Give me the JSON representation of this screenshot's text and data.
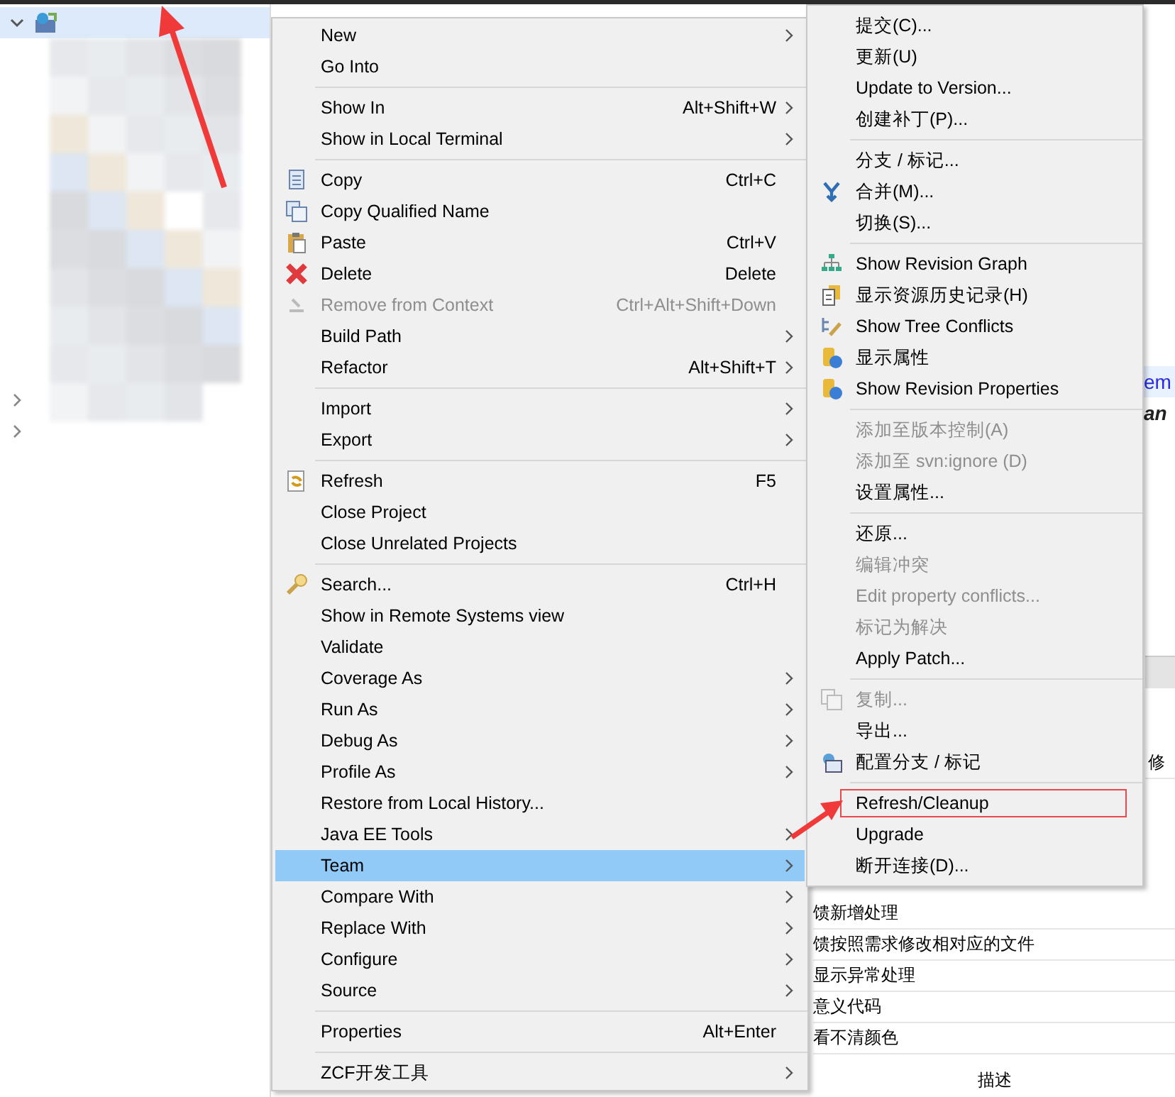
{
  "tree": {
    "items": [
      {
        "expanded": true
      },
      {
        "expanded": false
      },
      {
        "expanded": false
      }
    ]
  },
  "editor": {
    "lines": [
      {
        "text": "em",
        "current": true
      },
      {
        "text": "an",
        "current": false
      }
    ]
  },
  "table": {
    "rows": [
      "修",
      "馈新增处理",
      "馈按照需求修改相对应的文件",
      "显示异常处理",
      "意义代码",
      "看不清颜色"
    ],
    "header": "描述"
  },
  "menu": {
    "items": [
      {
        "kind": "item",
        "label": "New",
        "submenu": true,
        "disabled": false,
        "selected": false
      },
      {
        "kind": "item",
        "label": "Go Into",
        "submenu": false,
        "disabled": false,
        "selected": false
      },
      {
        "kind": "separator"
      },
      {
        "kind": "item",
        "label": "Show In",
        "shortcut": "Alt+Shift+W",
        "submenu": true,
        "disabled": false,
        "selected": false
      },
      {
        "kind": "item",
        "label": "Show in Local Terminal",
        "submenu": true,
        "disabled": false,
        "selected": false
      },
      {
        "kind": "separator"
      },
      {
        "kind": "item",
        "label": "Copy",
        "shortcut": "Ctrl+C",
        "submenu": false,
        "disabled": false,
        "selected": false
      },
      {
        "kind": "item",
        "label": "Copy Qualified Name",
        "submenu": false,
        "disabled": false,
        "selected": false
      },
      {
        "kind": "item",
        "label": "Paste",
        "shortcut": "Ctrl+V",
        "submenu": false,
        "disabled": false,
        "selected": false
      },
      {
        "kind": "item",
        "label": "Delete",
        "shortcut": "Delete",
        "submenu": false,
        "disabled": false,
        "selected": false
      },
      {
        "kind": "item",
        "label": "Remove from Context",
        "shortcut": "Ctrl+Alt+Shift+Down",
        "submenu": false,
        "disabled": true,
        "selected": false
      },
      {
        "kind": "item",
        "label": "Build Path",
        "submenu": true,
        "disabled": false,
        "selected": false
      },
      {
        "kind": "item",
        "label": "Refactor",
        "shortcut": "Alt+Shift+T",
        "submenu": true,
        "disabled": false,
        "selected": false
      },
      {
        "kind": "separator"
      },
      {
        "kind": "item",
        "label": "Import",
        "submenu": true,
        "disabled": false,
        "selected": false
      },
      {
        "kind": "item",
        "label": "Export",
        "submenu": true,
        "disabled": false,
        "selected": false
      },
      {
        "kind": "separator"
      },
      {
        "kind": "item",
        "label": "Refresh",
        "shortcut": "F5",
        "submenu": false,
        "disabled": false,
        "selected": false
      },
      {
        "kind": "item",
        "label": "Close Project",
        "submenu": false,
        "disabled": false,
        "selected": false
      },
      {
        "kind": "item",
        "label": "Close Unrelated Projects",
        "submenu": false,
        "disabled": false,
        "selected": false
      },
      {
        "kind": "separator"
      },
      {
        "kind": "item",
        "label": "Search...",
        "shortcut": "Ctrl+H",
        "submenu": false,
        "disabled": false,
        "selected": false
      },
      {
        "kind": "item",
        "label": "Show in Remote Systems view",
        "submenu": false,
        "disabled": false,
        "selected": false
      },
      {
        "kind": "item",
        "label": "Validate",
        "submenu": false,
        "disabled": false,
        "selected": false
      },
      {
        "kind": "item",
        "label": "Coverage As",
        "submenu": true,
        "disabled": false,
        "selected": false
      },
      {
        "kind": "item",
        "label": "Run As",
        "submenu": true,
        "disabled": false,
        "selected": false
      },
      {
        "kind": "item",
        "label": "Debug As",
        "submenu": true,
        "disabled": false,
        "selected": false
      },
      {
        "kind": "item",
        "label": "Profile As",
        "submenu": true,
        "disabled": false,
        "selected": false
      },
      {
        "kind": "item",
        "label": "Restore from Local History...",
        "submenu": false,
        "disabled": false,
        "selected": false
      },
      {
        "kind": "item",
        "label": "Java EE Tools",
        "submenu": true,
        "disabled": false,
        "selected": false
      },
      {
        "kind": "item",
        "label": "Team",
        "submenu": true,
        "disabled": false,
        "selected": true
      },
      {
        "kind": "item",
        "label": "Compare With",
        "submenu": true,
        "disabled": false,
        "selected": false
      },
      {
        "kind": "item",
        "label": "Replace With",
        "submenu": true,
        "disabled": false,
        "selected": false
      },
      {
        "kind": "item",
        "label": "Configure",
        "submenu": true,
        "disabled": false,
        "selected": false
      },
      {
        "kind": "item",
        "label": "Source",
        "submenu": true,
        "disabled": false,
        "selected": false
      },
      {
        "kind": "separator"
      },
      {
        "kind": "item",
        "label": "Properties",
        "shortcut": "Alt+Enter",
        "submenu": false,
        "disabled": false,
        "selected": false
      },
      {
        "kind": "separator"
      },
      {
        "kind": "item",
        "label": "ZCF开发工具",
        "submenu": true,
        "disabled": false,
        "selected": false
      }
    ]
  },
  "submenu": {
    "items": [
      {
        "kind": "item",
        "label": "提交(C)...",
        "disabled": false,
        "highlighted": false
      },
      {
        "kind": "item",
        "label": "更新(U)",
        "disabled": false,
        "highlighted": false
      },
      {
        "kind": "item",
        "label": "Update to Version...",
        "disabled": false,
        "highlighted": false
      },
      {
        "kind": "item",
        "label": "创建补丁(P)...",
        "disabled": false,
        "highlighted": false
      },
      {
        "kind": "separator"
      },
      {
        "kind": "item",
        "label": "分支 / 标记...",
        "disabled": false,
        "highlighted": false
      },
      {
        "kind": "item",
        "label": "合并(M)...",
        "disabled": false,
        "highlighted": false
      },
      {
        "kind": "item",
        "label": "切换(S)...",
        "disabled": false,
        "highlighted": false
      },
      {
        "kind": "separator"
      },
      {
        "kind": "item",
        "label": "Show Revision Graph",
        "disabled": false,
        "highlighted": false
      },
      {
        "kind": "item",
        "label": "显示资源历史记录(H)",
        "disabled": false,
        "highlighted": false
      },
      {
        "kind": "item",
        "label": "Show Tree Conflicts",
        "disabled": false,
        "highlighted": false
      },
      {
        "kind": "item",
        "label": "显示属性",
        "disabled": false,
        "highlighted": false
      },
      {
        "kind": "item",
        "label": "Show Revision Properties",
        "disabled": false,
        "highlighted": false
      },
      {
        "kind": "separator"
      },
      {
        "kind": "item",
        "label": "添加至版本控制(A)",
        "disabled": true,
        "highlighted": false
      },
      {
        "kind": "item",
        "label": "添加至 svn:ignore (D)",
        "disabled": true,
        "highlighted": false
      },
      {
        "kind": "item",
        "label": "设置属性...",
        "disabled": false,
        "highlighted": false
      },
      {
        "kind": "separator"
      },
      {
        "kind": "item",
        "label": "还原...",
        "disabled": false,
        "highlighted": false
      },
      {
        "kind": "item",
        "label": "编辑冲突",
        "disabled": true,
        "highlighted": false
      },
      {
        "kind": "item",
        "label": "Edit property conflicts...",
        "disabled": true,
        "highlighted": false
      },
      {
        "kind": "item",
        "label": "标记为解决",
        "disabled": true,
        "highlighted": false
      },
      {
        "kind": "item",
        "label": "Apply Patch...",
        "disabled": false,
        "highlighted": false
      },
      {
        "kind": "separator"
      },
      {
        "kind": "item",
        "label": "复制...",
        "disabled": true,
        "highlighted": false
      },
      {
        "kind": "item",
        "label": "导出...",
        "disabled": false,
        "highlighted": false
      },
      {
        "kind": "item",
        "label": "配置分支 / 标记",
        "disabled": false,
        "highlighted": false
      },
      {
        "kind": "separator"
      },
      {
        "kind": "item",
        "label": "Refresh/Cleanup",
        "disabled": false,
        "highlighted": true
      },
      {
        "kind": "item",
        "label": "Upgrade",
        "disabled": false,
        "highlighted": false
      },
      {
        "kind": "item",
        "label": "断开连接(D)...",
        "disabled": false,
        "highlighted": false
      }
    ]
  }
}
